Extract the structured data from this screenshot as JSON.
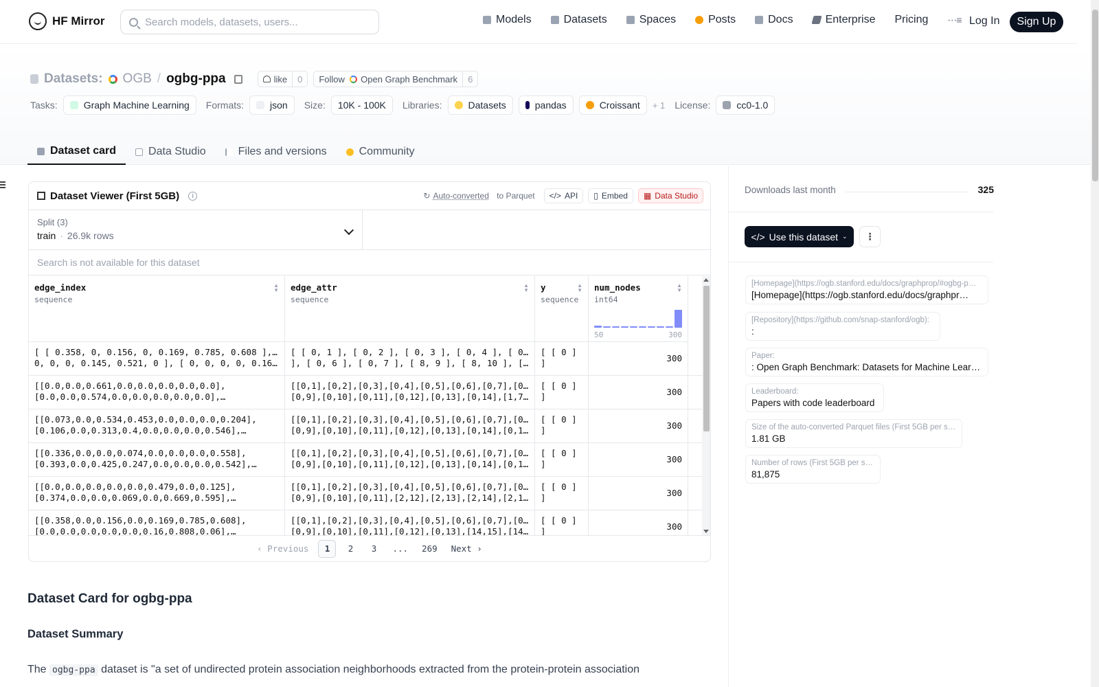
{
  "header": {
    "brand": "HF Mirror",
    "search_placeholder": "Search models, datasets, users...",
    "nav": [
      {
        "label": "Models",
        "icon": "cube-icon"
      },
      {
        "label": "Datasets",
        "icon": "database-icon"
      },
      {
        "label": "Spaces",
        "icon": "grid-icon"
      },
      {
        "label": "Posts",
        "icon": "posts-icon"
      },
      {
        "label": "Docs",
        "icon": "book-icon"
      },
      {
        "label": "Enterprise",
        "icon": "enterprise-icon"
      },
      {
        "label": "Pricing",
        "icon": ""
      }
    ],
    "login": "Log In",
    "signup": "Sign Up"
  },
  "repo": {
    "type_label": "Datasets:",
    "org": "OGB",
    "name": "ogbg-ppa",
    "like_label": "like",
    "like_count": "0",
    "follow_label": "Follow",
    "follow_org": "Open Graph Benchmark",
    "follow_count": "6"
  },
  "tags": {
    "tasks_label": "Tasks:",
    "task": "Graph Machine Learning",
    "formats_label": "Formats:",
    "format": "json",
    "size_label": "Size:",
    "size": "10K - 100K",
    "libraries_label": "Libraries:",
    "libraries": [
      "Datasets",
      "pandas",
      "Croissant"
    ],
    "more": "+ 1",
    "license_label": "License:",
    "license": "cc0-1.0"
  },
  "tabs": [
    "Dataset card",
    "Data Studio",
    "Files and versions",
    "Community"
  ],
  "viewer": {
    "title": "Dataset Viewer (First 5GB)",
    "auto_converted": "Auto-converted",
    "to_parquet": "to Parquet",
    "api": "API",
    "embed": "Embed",
    "data_studio": "Data Studio",
    "split_label": "Split (3)",
    "split_value": "train",
    "split_rows": "26.9k rows",
    "search_na": "Search is not available for this dataset",
    "columns": [
      {
        "name": "edge_index",
        "type": "sequence"
      },
      {
        "name": "edge_attr",
        "type": "sequence"
      },
      {
        "name": "y",
        "type": "sequence"
      },
      {
        "name": "num_nodes",
        "type": "int64"
      }
    ],
    "hist_min": "50",
    "hist_max": "300",
    "hist_bars": [
      0.1,
      0.08,
      0.07,
      0.06,
      0.05,
      0.05,
      0.05,
      0.05,
      0.05,
      1.0
    ],
    "rows": [
      {
        "c1": [
          "[ [ 0.358, 0, 0.156, 0, 0.169, 0.785, 0.608 ], [ 0,",
          "0, 0, 0, 0.145, 0.521, 0 ], [ 0, 0, 0, 0, 0.16,…"
        ],
        "c2": [
          "[ [ 0, 1 ], [ 0, 2 ], [ 0, 3 ], [ 0, 4 ], [ 0, 5",
          "], [ 0, 6 ], [ 0, 7 ], [ 8, 9 ], [ 8, 10 ], [ 11,…"
        ],
        "c3": [
          "[ [ 0 ]",
          "]"
        ],
        "c4": "300"
      },
      {
        "c1": [
          "[[0.0,0.0,0.661,0.0,0.0,0.0,0.0,0.0],",
          "[0.0,0.0,0.574,0.0,0.0,0.0,0.0,0.0],…"
        ],
        "c2": [
          "[[0,1],[0,2],[0,3],[0,4],[0,5],[0,6],[0,7],[0,8],",
          "[0,9],[0,10],[0,11],[0,12],[0,13],[0,14],[1,7],…"
        ],
        "c3": [
          "[ [ 0 ]",
          "]"
        ],
        "c4": "300"
      },
      {
        "c1": [
          "[[0.073,0.0,0.534,0.453,0.0,0.0,0.0,0.204],",
          "[0.106,0.0,0.313,0.4,0.0,0.0,0.0,0.546],…"
        ],
        "c2": [
          "[[0,1],[0,2],[0,3],[0,4],[0,5],[0,6],[0,7],[0,8],",
          "[0,9],[0,10],[0,11],[0,12],[0,13],[0,14],[0,15],…"
        ],
        "c3": [
          "[ [ 0 ]",
          "]"
        ],
        "c4": "300"
      },
      {
        "c1": [
          "[[0.336,0.0,0.0,0.074,0.0,0.0,0.0,0.558],",
          "[0.393,0.0,0.425,0.247,0.0,0.0,0.0,0.542],…"
        ],
        "c2": [
          "[[0,1],[0,2],[0,3],[0,4],[0,5],[0,6],[0,7],[0,8],",
          "[0,9],[0,10],[0,11],[0,12],[0,13],[0,14],[0,15],…"
        ],
        "c3": [
          "[ [ 0 ]",
          "]"
        ],
        "c4": "300"
      },
      {
        "c1": [
          "[[0.0,0.0,0.0,0.0,0.0,0.479,0.0,0.125],",
          "[0.374,0.0,0.0,0.069,0.0,0.669,0.595],…"
        ],
        "c2": [
          "[[0,1],[0,2],[0,3],[0,4],[0,5],[0,6],[0,7],[0,8],",
          "[0,9],[0,10],[0,11],[2,12],[2,13],[2,14],[2,15],…"
        ],
        "c3": [
          "[ [ 0 ]",
          "]"
        ],
        "c4": "300"
      },
      {
        "c1": [
          "[[0.358,0.0,0.156,0.0,0.169,0.785,0.608],",
          "[0.0,0.0,0.0,0.0,0.0,0.16,0.808,0.06],…"
        ],
        "c2": [
          "[[0,1],[0,2],[0,3],[0,4],[0,5],[0,6],[0,7],[0,8],",
          "[0,9],[0,10],[0,11],[0,12],[0,13],[14,15],[14,16]…"
        ],
        "c3": [
          "[ [ 0 ]",
          "]"
        ],
        "c4": "300"
      }
    ],
    "pager": {
      "prev": "Previous",
      "pages": [
        "1",
        "2",
        "3",
        "...",
        "269"
      ],
      "next": "Next"
    }
  },
  "card": {
    "title": "Dataset Card for ogbg-ppa",
    "summary_heading": "Dataset Summary",
    "para_before": "The",
    "para_code": "ogbg-ppa",
    "para_after": "dataset is \"a set of undirected protein association neighborhoods extracted from the protein-protein association"
  },
  "sidebar": {
    "downloads_label": "Downloads last month",
    "downloads": "325",
    "use_button": "Use this dataset",
    "meta": [
      {
        "k": "[Homepage](https://ogb.stanford.edu/docs/graphprop/#ogbg-p…",
        "v": "[Homepage](https://ogb.stanford.edu/docs/graphpr…"
      },
      {
        "k": "[Repository](https://github.com/snap-stanford/ogb):",
        "v": ":"
      },
      {
        "k": "Paper:",
        "v": ": Open Graph Benchmark: Datasets for Machine Learni…"
      },
      {
        "k": "Leaderboard:",
        "v": "Papers with code leaderboard"
      },
      {
        "k": "Size of the auto-converted Parquet files (First 5GB per split):",
        "v": "1.81 GB"
      },
      {
        "k": "Number of rows (First 5GB per split):",
        "v": "81,875"
      }
    ]
  }
}
